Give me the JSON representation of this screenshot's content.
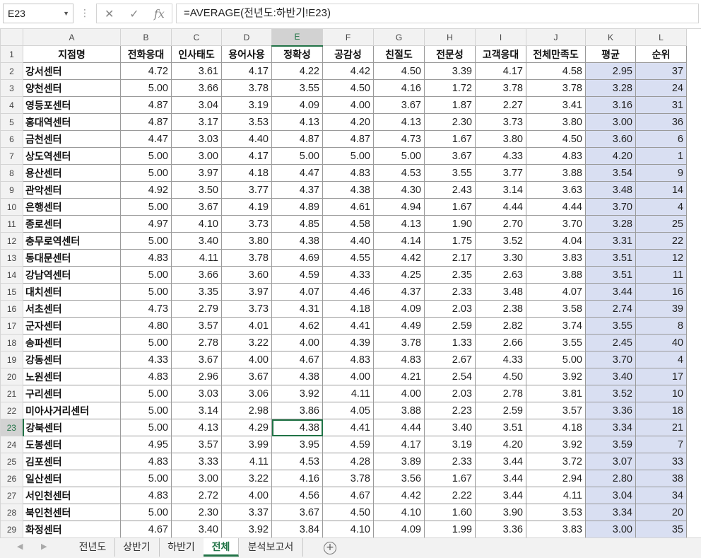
{
  "formula_bar": {
    "name_box": "E23",
    "cancel_icon": "✕",
    "enter_icon": "✓",
    "fx_label": "fx",
    "formula": "=AVERAGE(전년도:하반기!E23)"
  },
  "columns": [
    "A",
    "B",
    "C",
    "D",
    "E",
    "F",
    "G",
    "H",
    "I",
    "J",
    "K",
    "L"
  ],
  "selected_column": "E",
  "selected_row": 23,
  "header_row": [
    "지점명",
    "전화응대",
    "인사태도",
    "용어사용",
    "정확성",
    "공감성",
    "친절도",
    "전문성",
    "고객응대",
    "전체만족도",
    "평균",
    "순위"
  ],
  "rows": [
    {
      "n": "2",
      "c": [
        "강서센터",
        "4.72",
        "3.61",
        "4.17",
        "4.22",
        "4.42",
        "4.50",
        "3.39",
        "4.17",
        "4.58",
        "2.95",
        "37"
      ]
    },
    {
      "n": "3",
      "c": [
        "양천센터",
        "5.00",
        "3.66",
        "3.78",
        "3.55",
        "4.50",
        "4.16",
        "1.72",
        "3.78",
        "3.78",
        "3.28",
        "24"
      ]
    },
    {
      "n": "4",
      "c": [
        "영등포센터",
        "4.87",
        "3.04",
        "3.19",
        "4.09",
        "4.00",
        "3.67",
        "1.87",
        "2.27",
        "3.41",
        "3.16",
        "31"
      ]
    },
    {
      "n": "5",
      "c": [
        "홍대역센터",
        "4.87",
        "3.17",
        "3.53",
        "4.13",
        "4.20",
        "4.13",
        "2.30",
        "3.73",
        "3.80",
        "3.00",
        "36"
      ]
    },
    {
      "n": "6",
      "c": [
        "금천센터",
        "4.47",
        "3.03",
        "4.40",
        "4.87",
        "4.87",
        "4.73",
        "1.67",
        "3.80",
        "4.50",
        "3.60",
        "6"
      ]
    },
    {
      "n": "7",
      "c": [
        "상도역센터",
        "5.00",
        "3.00",
        "4.17",
        "5.00",
        "5.00",
        "5.00",
        "3.67",
        "4.33",
        "4.83",
        "4.20",
        "1"
      ]
    },
    {
      "n": "8",
      "c": [
        "용산센터",
        "5.00",
        "3.97",
        "4.18",
        "4.47",
        "4.83",
        "4.53",
        "3.55",
        "3.77",
        "3.88",
        "3.54",
        "9"
      ]
    },
    {
      "n": "9",
      "c": [
        "관악센터",
        "4.92",
        "3.50",
        "3.77",
        "4.37",
        "4.38",
        "4.30",
        "2.43",
        "3.14",
        "3.63",
        "3.48",
        "14"
      ]
    },
    {
      "n": "10",
      "c": [
        "은행센터",
        "5.00",
        "3.67",
        "4.19",
        "4.89",
        "4.61",
        "4.94",
        "1.67",
        "4.44",
        "4.44",
        "3.70",
        "4"
      ]
    },
    {
      "n": "11",
      "c": [
        "종로센터",
        "4.97",
        "4.10",
        "3.73",
        "4.85",
        "4.58",
        "4.13",
        "1.90",
        "2.70",
        "3.70",
        "3.28",
        "25"
      ]
    },
    {
      "n": "12",
      "c": [
        "충무로역센터",
        "5.00",
        "3.40",
        "3.80",
        "4.38",
        "4.40",
        "4.14",
        "1.75",
        "3.52",
        "4.04",
        "3.31",
        "22"
      ]
    },
    {
      "n": "13",
      "c": [
        "동대문센터",
        "4.83",
        "4.11",
        "3.78",
        "4.69",
        "4.55",
        "4.42",
        "2.17",
        "3.30",
        "3.83",
        "3.51",
        "12"
      ]
    },
    {
      "n": "14",
      "c": [
        "강남역센터",
        "5.00",
        "3.66",
        "3.60",
        "4.59",
        "4.33",
        "4.25",
        "2.35",
        "2.63",
        "3.88",
        "3.51",
        "11"
      ]
    },
    {
      "n": "15",
      "c": [
        "대치센터",
        "5.00",
        "3.35",
        "3.97",
        "4.07",
        "4.46",
        "4.37",
        "2.33",
        "3.48",
        "4.07",
        "3.44",
        "16"
      ]
    },
    {
      "n": "16",
      "c": [
        "서초센터",
        "4.73",
        "2.79",
        "3.73",
        "4.31",
        "4.18",
        "4.09",
        "2.03",
        "2.38",
        "3.58",
        "2.74",
        "39"
      ]
    },
    {
      "n": "17",
      "c": [
        "군자센터",
        "4.80",
        "3.57",
        "4.01",
        "4.62",
        "4.41",
        "4.49",
        "2.59",
        "2.82",
        "3.74",
        "3.55",
        "8"
      ]
    },
    {
      "n": "18",
      "c": [
        "송파센터",
        "5.00",
        "2.78",
        "3.22",
        "4.00",
        "4.39",
        "3.78",
        "1.33",
        "2.66",
        "3.55",
        "2.45",
        "40"
      ]
    },
    {
      "n": "19",
      "c": [
        "강동센터",
        "4.33",
        "3.67",
        "4.00",
        "4.67",
        "4.83",
        "4.83",
        "2.67",
        "4.33",
        "5.00",
        "3.70",
        "4"
      ]
    },
    {
      "n": "20",
      "c": [
        "노원센터",
        "4.83",
        "2.96",
        "3.67",
        "4.38",
        "4.00",
        "4.21",
        "2.54",
        "4.50",
        "3.92",
        "3.40",
        "17"
      ]
    },
    {
      "n": "21",
      "c": [
        "구리센터",
        "5.00",
        "3.03",
        "3.06",
        "3.92",
        "4.11",
        "4.00",
        "2.03",
        "2.78",
        "3.81",
        "3.52",
        "10"
      ]
    },
    {
      "n": "22",
      "c": [
        "미아사거리센터",
        "5.00",
        "3.14",
        "2.98",
        "3.86",
        "4.05",
        "3.88",
        "2.23",
        "2.59",
        "3.57",
        "3.36",
        "18"
      ]
    },
    {
      "n": "23",
      "c": [
        "강북센터",
        "5.00",
        "4.13",
        "4.29",
        "4.38",
        "4.41",
        "4.44",
        "3.40",
        "3.51",
        "4.18",
        "3.34",
        "21"
      ]
    },
    {
      "n": "24",
      "c": [
        "도봉센터",
        "4.95",
        "3.57",
        "3.99",
        "3.95",
        "4.59",
        "4.17",
        "3.19",
        "4.20",
        "3.92",
        "3.59",
        "7"
      ]
    },
    {
      "n": "25",
      "c": [
        "김포센터",
        "4.83",
        "3.33",
        "4.11",
        "4.53",
        "4.28",
        "3.89",
        "2.33",
        "3.44",
        "3.72",
        "3.07",
        "33"
      ]
    },
    {
      "n": "26",
      "c": [
        "일산센터",
        "5.00",
        "3.00",
        "3.22",
        "4.16",
        "3.78",
        "3.56",
        "1.67",
        "3.44",
        "2.94",
        "2.80",
        "38"
      ]
    },
    {
      "n": "27",
      "c": [
        "서인천센터",
        "4.83",
        "2.72",
        "4.00",
        "4.56",
        "4.67",
        "4.42",
        "2.22",
        "3.44",
        "4.11",
        "3.04",
        "34"
      ]
    },
    {
      "n": "28",
      "c": [
        "북인천센터",
        "5.00",
        "2.30",
        "3.37",
        "3.67",
        "4.50",
        "4.10",
        "1.60",
        "3.90",
        "3.53",
        "3.34",
        "20"
      ]
    },
    {
      "n": "29",
      "c": [
        "화정센터",
        "4.67",
        "3.40",
        "3.92",
        "3.84",
        "4.10",
        "4.09",
        "1.99",
        "3.36",
        "3.83",
        "3.00",
        "35"
      ]
    }
  ],
  "sheet_tabs": [
    {
      "label": "전년도",
      "active": false
    },
    {
      "label": "상반기",
      "active": false
    },
    {
      "label": "하반기",
      "active": false
    },
    {
      "label": "전체",
      "active": true
    },
    {
      "label": "분석보고서",
      "active": false
    }
  ],
  "tab_nav": {
    "prev": "◀",
    "next": "▶"
  },
  "add_sheet_label": "+",
  "colors": {
    "accent": "#217346",
    "shade": "#d9dff2"
  }
}
